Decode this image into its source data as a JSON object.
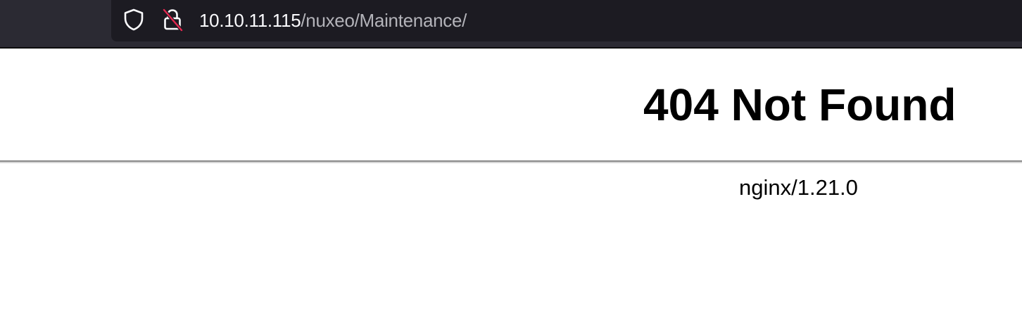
{
  "browser": {
    "url_host": "10.10.11.115",
    "url_path": "/nuxeo/Maintenance/",
    "icons": [
      "shield-icon",
      "insecure-lock-icon"
    ],
    "accent_colors": {
      "toolbar_bg": "#2b2a33",
      "urlbar_bg": "#1c1b22",
      "insecure_slash": "#e22850"
    }
  },
  "page": {
    "heading": "404 Not Found",
    "server_signature": "nginx/1.21.0"
  }
}
